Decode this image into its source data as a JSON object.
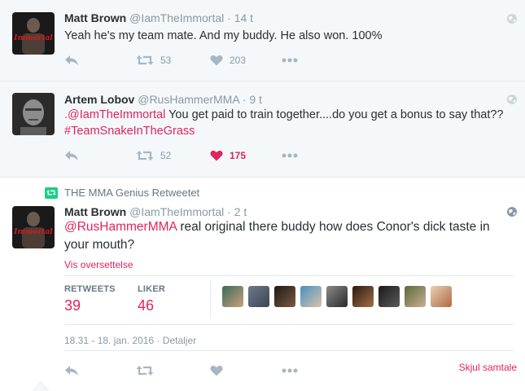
{
  "tweets": [
    {
      "name": "Matt Brown",
      "handle": "@IamTheImmortal",
      "dot": "·",
      "time": "14 t",
      "text": "Yeah he's my team mate. And my buddy. He also won. 100%",
      "retweets": "53",
      "likes": "203",
      "avatar_label": "Immortal"
    },
    {
      "name": "Artem Lobov",
      "handle": "@RusHammerMMA",
      "dot": "·",
      "time": "9 t",
      "mention": ".@IamTheImmortal",
      "text": " You get paid to train together....do you get a bonus to say that?? ",
      "hashtag": "#TeamSnakeInTheGrass",
      "retweets": "52",
      "likes": "175"
    },
    {
      "retweet_note": "THE MMA Genius Retweetet",
      "name": "Matt Brown",
      "handle": "@IamTheImmortal",
      "dot": "·",
      "time": "2 t",
      "mention": "@RusHammerMMA",
      "text": " real original there buddy how does Conor's dick taste in your mouth?",
      "translate": "Vis oversettelse",
      "retweets_label": "RETWEETS",
      "retweets": "39",
      "likes_label": "LIKER",
      "likes": "46",
      "timestamp": "18.31 - 18. jan. 2016",
      "details": "Detaljer",
      "hide_conversation": "Skjul samtale",
      "avatar_label": "Immortal"
    }
  ],
  "colors": {
    "accent": "#e0245e",
    "muted": "#8899a6",
    "retweet_green": "#19cf86",
    "background_gray": "#f5f8fa"
  },
  "icons": [
    "reply-icon",
    "retweet-icon",
    "heart-icon",
    "more-icon",
    "globe-icon"
  ]
}
